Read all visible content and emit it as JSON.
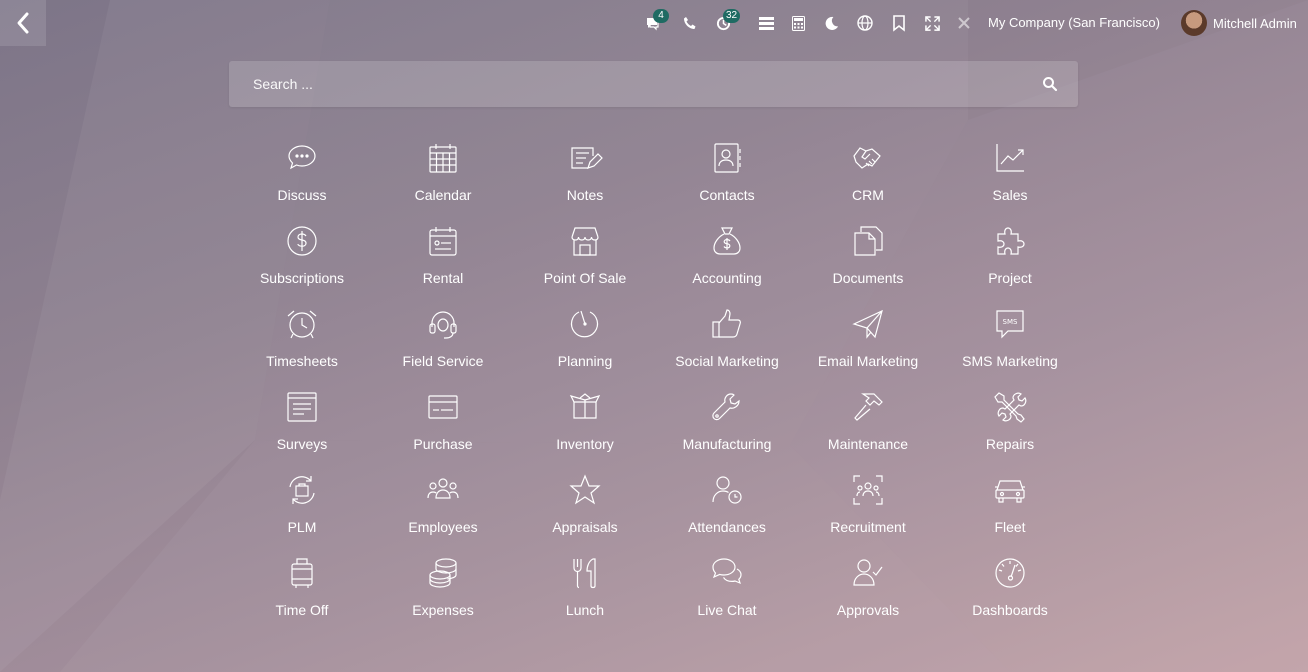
{
  "topbar": {
    "back_icon": "chevron-left-icon",
    "tray": [
      {
        "name": "chat-icon",
        "badge": "4"
      },
      {
        "name": "phone-icon",
        "badge": ""
      },
      {
        "name": "activity-clock-icon",
        "badge": "32"
      },
      {
        "name": "list-icon",
        "badge": ""
      },
      {
        "name": "calculator-icon",
        "badge": ""
      },
      {
        "name": "moon-icon",
        "badge": ""
      },
      {
        "name": "globe-icon",
        "badge": ""
      },
      {
        "name": "bookmark-icon",
        "badge": ""
      },
      {
        "name": "expand-icon",
        "badge": ""
      },
      {
        "name": "tools-icon",
        "badge": ""
      }
    ],
    "company": "My Company (San Francisco)",
    "user_name": "Mitchell Admin"
  },
  "search": {
    "placeholder": "Search ...",
    "value": ""
  },
  "apps": [
    {
      "label": "Discuss",
      "icon": "chat-bubble-icon"
    },
    {
      "label": "Calendar",
      "icon": "calendar-icon"
    },
    {
      "label": "Notes",
      "icon": "notes-icon"
    },
    {
      "label": "Contacts",
      "icon": "contacts-icon"
    },
    {
      "label": "CRM",
      "icon": "handshake-icon"
    },
    {
      "label": "Sales",
      "icon": "chart-line-icon"
    },
    {
      "label": "Subscriptions",
      "icon": "dollar-circle-icon"
    },
    {
      "label": "Rental",
      "icon": "rental-calendar-icon"
    },
    {
      "label": "Point Of Sale",
      "icon": "store-icon"
    },
    {
      "label": "Accounting",
      "icon": "money-bag-icon"
    },
    {
      "label": "Documents",
      "icon": "documents-icon"
    },
    {
      "label": "Project",
      "icon": "puzzle-icon"
    },
    {
      "label": "Timesheets",
      "icon": "alarm-clock-icon"
    },
    {
      "label": "Field Service",
      "icon": "headset-icon"
    },
    {
      "label": "Planning",
      "icon": "planning-circle-icon"
    },
    {
      "label": "Social Marketing",
      "icon": "thumbs-up-icon"
    },
    {
      "label": "Email Marketing",
      "icon": "paper-plane-icon"
    },
    {
      "label": "SMS Marketing",
      "icon": "sms-bubble-icon"
    },
    {
      "label": "Surveys",
      "icon": "survey-form-icon"
    },
    {
      "label": "Purchase",
      "icon": "credit-card-icon"
    },
    {
      "label": "Inventory",
      "icon": "box-icon"
    },
    {
      "label": "Manufacturing",
      "icon": "wrench-icon"
    },
    {
      "label": "Maintenance",
      "icon": "hammer-icon"
    },
    {
      "label": "Repairs",
      "icon": "tools-cross-icon"
    },
    {
      "label": "PLM",
      "icon": "plm-cycle-icon"
    },
    {
      "label": "Employees",
      "icon": "people-icon"
    },
    {
      "label": "Appraisals",
      "icon": "star-icon"
    },
    {
      "label": "Attendances",
      "icon": "person-clock-icon"
    },
    {
      "label": "Recruitment",
      "icon": "recruit-frame-icon"
    },
    {
      "label": "Fleet",
      "icon": "car-icon"
    },
    {
      "label": "Time Off",
      "icon": "suitcase-icon"
    },
    {
      "label": "Expenses",
      "icon": "coins-icon"
    },
    {
      "label": "Lunch",
      "icon": "fork-knife-icon"
    },
    {
      "label": "Live Chat",
      "icon": "chat-double-icon"
    },
    {
      "label": "Approvals",
      "icon": "person-check-icon"
    },
    {
      "label": "Dashboards",
      "icon": "gauge-icon"
    }
  ],
  "colors": {
    "badge": "#1f6b63",
    "text": "#ffffff"
  }
}
